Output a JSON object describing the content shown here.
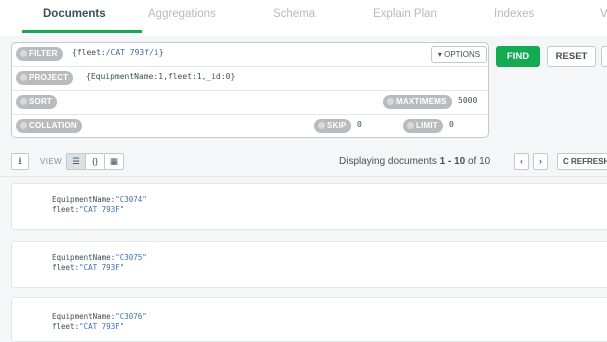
{
  "tabs": [
    {
      "label": "Documents",
      "active": true
    },
    {
      "label": "Aggregations",
      "active": false
    },
    {
      "label": "Schema",
      "active": false
    },
    {
      "label": "Explain Plan",
      "active": false
    },
    {
      "label": "Indexes",
      "active": false
    },
    {
      "label": "V",
      "active": false
    }
  ],
  "query": {
    "filter_label": "FILTER",
    "filter_prefix": "{fleet:",
    "filter_value": "/CAT 793f/i",
    "filter_suffix": "}",
    "options_label": "▾ OPTIONS",
    "project_label": "PROJECT",
    "project_value": "{EquipmentName:1,fleet:1,_id:0}",
    "sort_label": "SORT",
    "maxtimems_label": "MAXTIMEMS",
    "maxtimems_value": "5000",
    "collation_label": "COLLATION",
    "skip_label": "SKIP",
    "skip_value": "0",
    "limit_label": "LIMIT",
    "limit_value": "0"
  },
  "actions": {
    "find": "FIND",
    "reset": "RESET"
  },
  "toolbar": {
    "view_label": "VIEW",
    "view_list_icon": "☰",
    "view_json_icon": "{}",
    "view_table_icon": "▦",
    "export_icon": "⭳",
    "display_prefix": "Displaying documents ",
    "display_from": "1",
    "display_dash": " - ",
    "display_to": "10",
    "display_of": " of 10",
    "prev_icon": "‹",
    "next_icon": "›",
    "refresh_label": "C REFRESH"
  },
  "documents": [
    {
      "key1": "EquipmentName:",
      "val1": "\"C3074\"",
      "key2": "fleet:",
      "val2": "\"CAT 793F\""
    },
    {
      "key1": "EquipmentName:",
      "val1": "\"C3075\"",
      "key2": "fleet:",
      "val2": "\"CAT 793F\""
    },
    {
      "key1": "EquipmentName:",
      "val1": "\"C3076\"",
      "key2": "fleet:",
      "val2": "\"CAT 793F\""
    }
  ]
}
